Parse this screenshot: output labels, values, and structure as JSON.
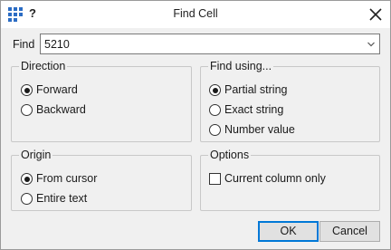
{
  "window": {
    "title": "Find Cell",
    "help_glyph": "?",
    "app_icon": "grid-app-icon",
    "close_icon": "close-icon"
  },
  "find": {
    "label": "Find",
    "value": "5210",
    "dropdown_icon": "chevron-down-icon"
  },
  "direction": {
    "title": "Direction",
    "options": [
      {
        "label": "Forward",
        "checked": true
      },
      {
        "label": "Backward",
        "checked": false
      }
    ]
  },
  "find_using": {
    "title": "Find using...",
    "options": [
      {
        "label": "Partial string",
        "checked": true
      },
      {
        "label": "Exact string",
        "checked": false
      },
      {
        "label": "Number value",
        "checked": false
      }
    ]
  },
  "origin": {
    "title": "Origin",
    "options": [
      {
        "label": "From cursor",
        "checked": true
      },
      {
        "label": "Entire text",
        "checked": false
      }
    ]
  },
  "options": {
    "title": "Options",
    "current_column_only": {
      "label": "Current column only",
      "checked": false
    }
  },
  "buttons": {
    "ok": "OK",
    "cancel": "Cancel"
  },
  "colors": {
    "accent": "#0078d7",
    "icon_blue": "#2b6cc4"
  }
}
